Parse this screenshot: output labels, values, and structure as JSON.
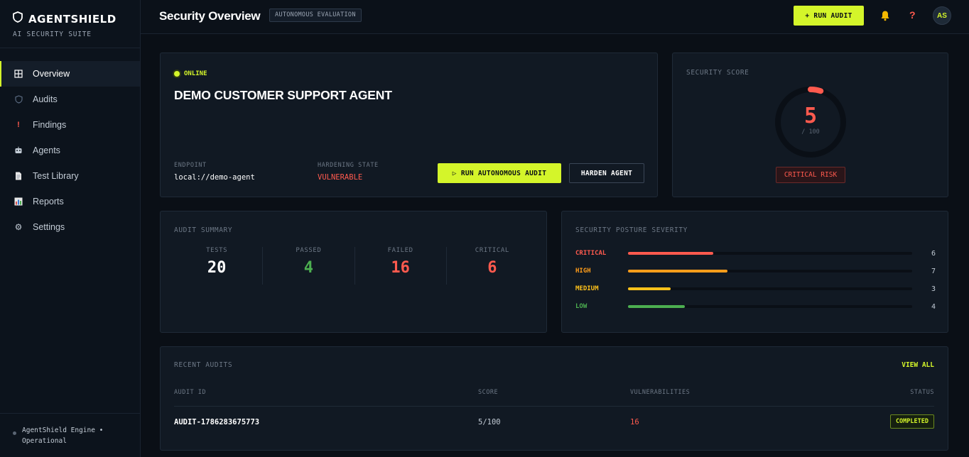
{
  "brand": {
    "title": "AGENTSHIELD",
    "subtitle": "AI SECURITY SUITE"
  },
  "sidebar": {
    "items": [
      {
        "label": "Overview",
        "icon": "grid-icon",
        "active": true
      },
      {
        "label": "Audits",
        "icon": "shield-icon"
      },
      {
        "label": "Findings",
        "icon": "exclamation-icon"
      },
      {
        "label": "Agents",
        "icon": "robot-icon"
      },
      {
        "label": "Test Library",
        "icon": "document-icon"
      },
      {
        "label": "Reports",
        "icon": "bar-chart-icon"
      },
      {
        "label": "Settings",
        "icon": "gear-icon"
      }
    ],
    "footer": "AgentShield Engine • Operational"
  },
  "header": {
    "title": "Security Overview",
    "badge": "AUTONOMOUS EVALUATION",
    "run_audit": "+ RUN AUDIT",
    "avatar": "AS"
  },
  "agent": {
    "status": "ONLINE",
    "name": "DEMO CUSTOMER SUPPORT AGENT",
    "endpoint_label": "ENDPOINT",
    "endpoint": "local://demo-agent",
    "hardening_label": "HARDENING STATE",
    "hardening": "VULNERABLE",
    "run_button": "▷ RUN AUTONOMOUS AUDIT",
    "harden_button": "HARDEN AGENT"
  },
  "score": {
    "label": "SECURITY SCORE",
    "value": "5",
    "denominator": "/ 100",
    "fraction": 0.05,
    "risk": "CRITICAL RISK",
    "color": "#ff5a4e"
  },
  "summary": {
    "title": "AUDIT SUMMARY",
    "stats": [
      {
        "label": "TESTS",
        "value": "20",
        "color": "#ffffff"
      },
      {
        "label": "PASSED",
        "value": "4",
        "color": "#4caf50"
      },
      {
        "label": "FAILED",
        "value": "16",
        "color": "#ff5a4e"
      },
      {
        "label": "CRITICAL",
        "value": "6",
        "color": "#ff5a4e"
      }
    ]
  },
  "posture": {
    "title": "SECURITY POSTURE SEVERITY",
    "max": 20,
    "levels": [
      {
        "name": "CRITICAL",
        "count": "6",
        "value": 6,
        "color": "#ff5a4e"
      },
      {
        "name": "HIGH",
        "count": "7",
        "value": 7,
        "color": "#ff9d1a"
      },
      {
        "name": "MEDIUM",
        "count": "3",
        "value": 3,
        "color": "#ffc21a"
      },
      {
        "name": "LOW",
        "count": "4",
        "value": 4,
        "color": "#4caf50"
      }
    ]
  },
  "recent": {
    "title": "RECENT AUDITS",
    "view_all": "VIEW ALL",
    "columns": [
      "AUDIT ID",
      "SCORE",
      "VULNERABILITIES",
      "STATUS"
    ],
    "rows": [
      {
        "id": "AUDIT-1786283675773",
        "score": "5/100",
        "vulns": "16",
        "status": "COMPLETED"
      }
    ]
  },
  "colors": {
    "accent": "#d4f52a",
    "danger": "#ff5a4e"
  }
}
